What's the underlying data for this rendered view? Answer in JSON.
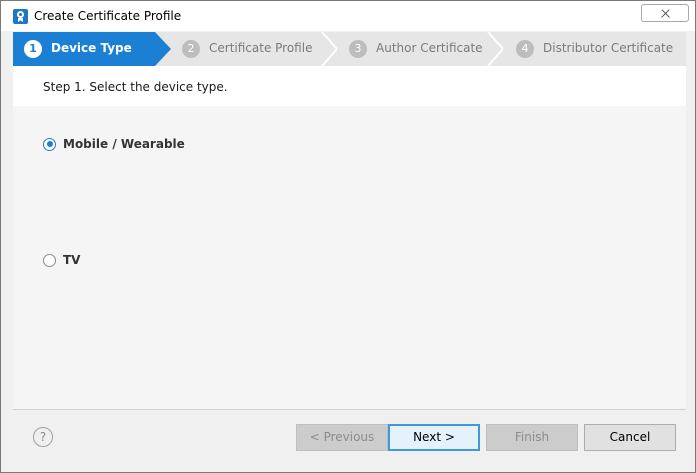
{
  "window": {
    "title": "Create Certificate Profile"
  },
  "steps": [
    {
      "number": "1",
      "label": "Device Type",
      "state": "active"
    },
    {
      "number": "2",
      "label": "Certificate Profile",
      "state": "inactive"
    },
    {
      "number": "3",
      "label": "Author Certificate",
      "state": "inactive"
    },
    {
      "number": "4",
      "label": "Distributor Certificate",
      "state": "inactive"
    }
  ],
  "instruction": "Step 1. Select the device type.",
  "device_options": [
    {
      "label": "Mobile / Wearable",
      "selected": true
    },
    {
      "label": "TV",
      "selected": false
    }
  ],
  "footer": {
    "help_icon": "?",
    "previous_label": "< Previous",
    "next_label": "Next >",
    "finish_label": "Finish",
    "cancel_label": "Cancel"
  },
  "colors": {
    "accent": "#1b7fd4",
    "step_inactive": "#e6e6e6"
  }
}
